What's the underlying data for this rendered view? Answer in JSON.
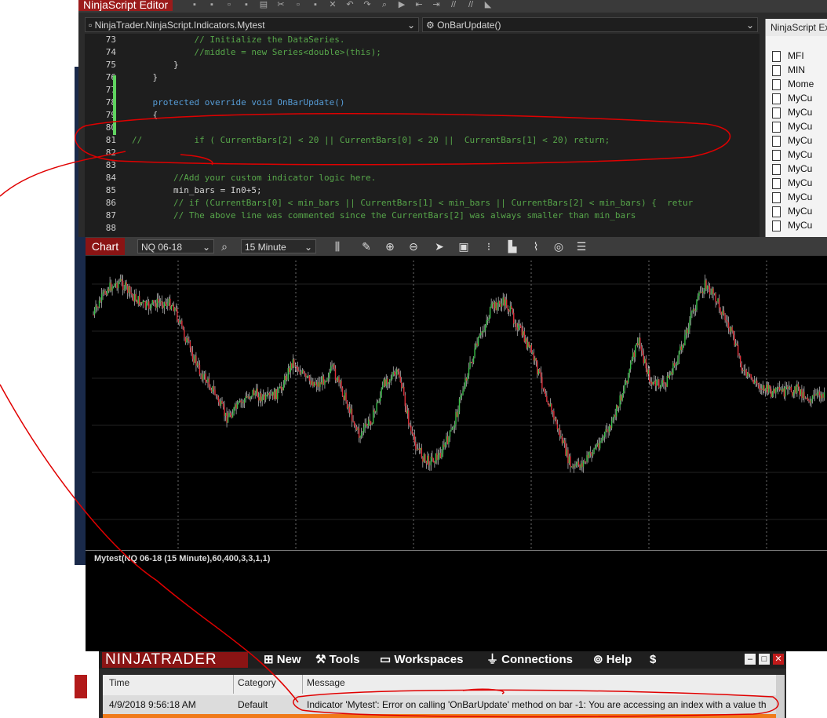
{
  "editor": {
    "title": "NinjaScript Editor",
    "file_path": "NinjaTrader.NinjaScript.Indicators.Mytest",
    "method": "OnBarUpdate()",
    "lines": [
      {
        "n": "73",
        "text": "            // Initialize the DataSeries."
      },
      {
        "n": "74",
        "text": "            //middle = new Series<double>(this);"
      },
      {
        "n": "75",
        "text": "        }"
      },
      {
        "n": "76",
        "text": "    }"
      },
      {
        "n": "77",
        "text": ""
      },
      {
        "n": "78",
        "text": "    protected override void OnBarUpdate()"
      },
      {
        "n": "79",
        "text": "    {"
      },
      {
        "n": "80",
        "text": ""
      },
      {
        "n": "81",
        "text": "//          if ( CurrentBars[2] < 20 || CurrentBars[0] < 20 ||  CurrentBars[1] < 20) return;"
      },
      {
        "n": "82",
        "text": ""
      },
      {
        "n": "83",
        "text": ""
      },
      {
        "n": "84",
        "text": "        //Add your custom indicator logic here."
      },
      {
        "n": "85",
        "text": "        min_bars = In0+5;"
      },
      {
        "n": "86",
        "text": "        // if (CurrentBars[0] < min_bars || CurrentBars[1] < min_bars || CurrentBars[2] < min_bars) {  retur"
      },
      {
        "n": "87",
        "text": "        // The above line was commented since the CurrentBars[2] was always smaller than min_bars"
      },
      {
        "n": "88",
        "text": ""
      }
    ]
  },
  "explorer": {
    "title": "NinjaScript Ex",
    "items": [
      "MFI",
      "MIN",
      "Mome",
      "MyCu",
      "MyCu",
      "MyCu",
      "MyCu",
      "MyCu",
      "MyCu",
      "MyCu",
      "MyCu",
      "MyCu",
      "MyCu"
    ]
  },
  "chart": {
    "tab_label": "Chart",
    "instrument": "NQ 06-18",
    "interval": "15 Minute",
    "indicator_label": "Mytest(NQ 06-18 (15 Minute),60,400,3,3,1,1)"
  },
  "chart_data": {
    "type": "candlestick",
    "title": "",
    "instrument": "NQ 06-18",
    "interval": "15 Minute",
    "price_path": [
      0.15,
      0.05,
      0.02,
      0.08,
      0.12,
      0.1,
      0.11,
      0.25,
      0.37,
      0.44,
      0.55,
      0.5,
      0.45,
      0.48,
      0.45,
      0.33,
      0.4,
      0.42,
      0.36,
      0.48,
      0.62,
      0.55,
      0.4,
      0.38,
      0.63,
      0.72,
      0.7,
      0.6,
      0.4,
      0.25,
      0.12,
      0.1,
      0.2,
      0.3,
      0.45,
      0.6,
      0.75,
      0.72,
      0.65,
      0.58,
      0.42,
      0.25,
      0.42,
      0.42,
      0.32,
      0.15,
      0.03,
      0.1,
      0.22,
      0.38,
      0.42,
      0.45,
      0.45,
      0.44,
      0.48,
      0.45
    ]
  },
  "control_center": {
    "logo": "NINJATRADER",
    "menu": [
      {
        "label": "New",
        "icon": "new-icon"
      },
      {
        "label": "Tools",
        "icon": "tools-icon"
      },
      {
        "label": "Workspaces",
        "icon": "workspaces-icon"
      },
      {
        "label": "Connections",
        "icon": "connections-icon"
      },
      {
        "label": "Help",
        "icon": "help-icon"
      },
      {
        "label": "$",
        "icon": "dollar-icon"
      }
    ],
    "columns": [
      "Time",
      "Category",
      "Message"
    ],
    "rows": [
      {
        "time": "4/9/2018 9:56:18 AM",
        "category": "Default",
        "message": "Indicator 'Mytest': Error on calling 'OnBarUpdate' method on bar -1: You are accessing an index with a value th"
      }
    ]
  },
  "colors": {
    "up": "#39c14a",
    "down": "#e0303a",
    "accent": "#8a1414",
    "annotation": "#e00000"
  }
}
